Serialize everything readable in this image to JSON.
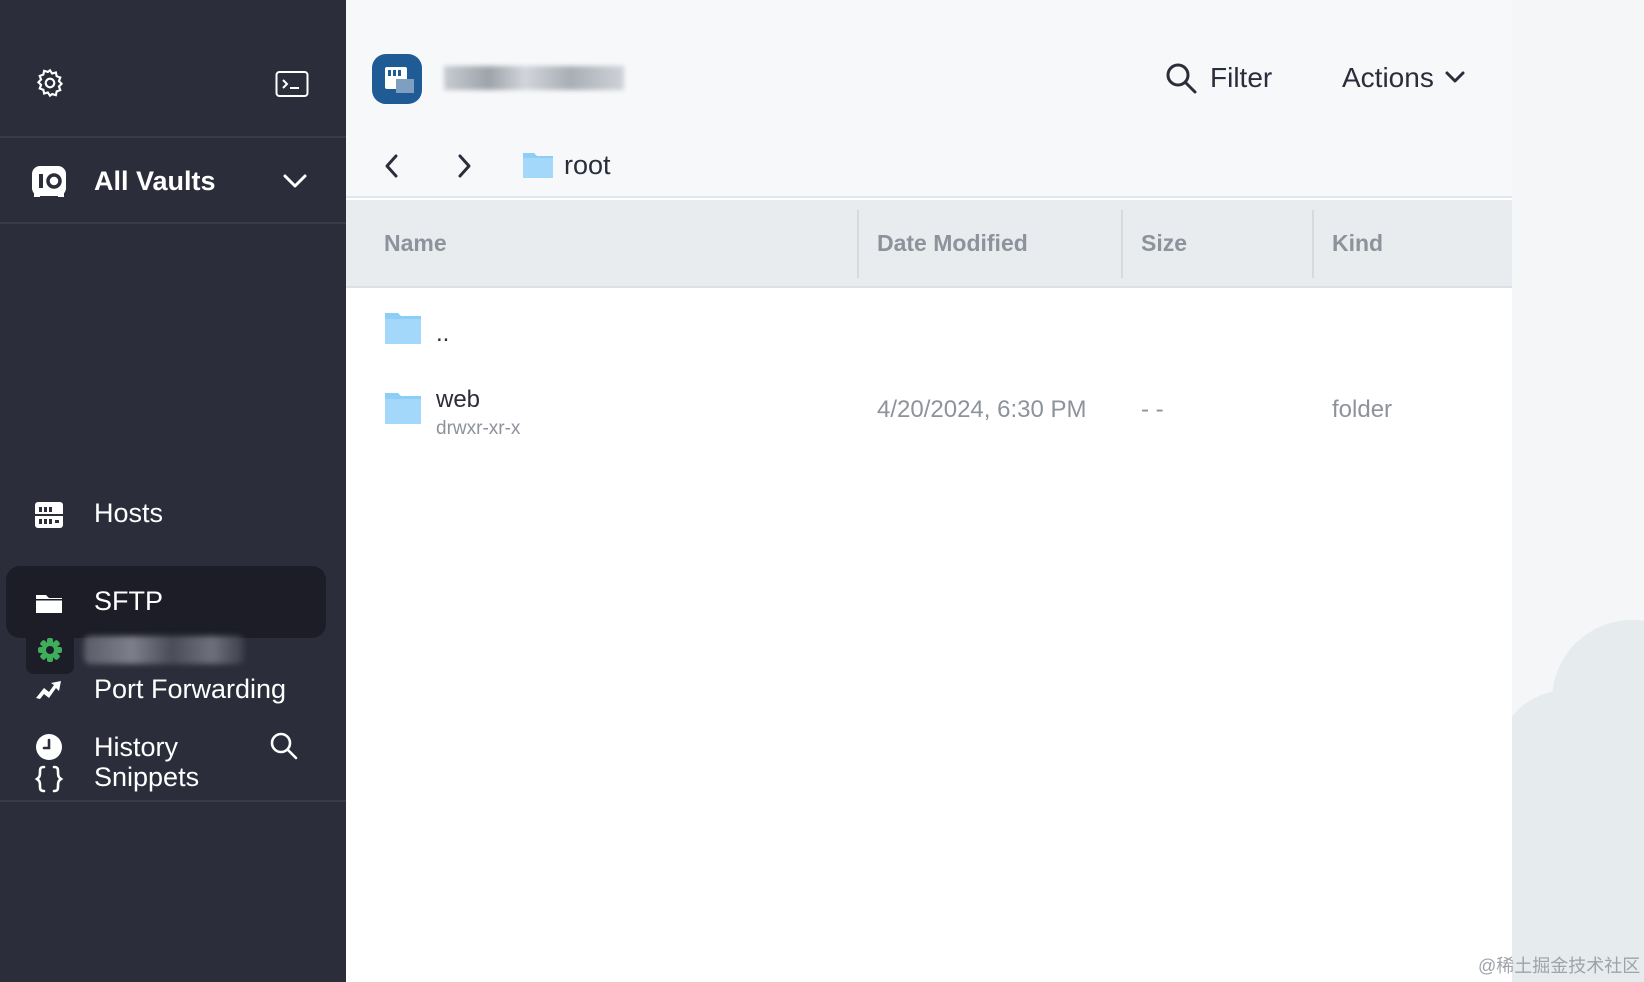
{
  "sidebar": {
    "vault_label": "All Vaults",
    "nav": [
      {
        "label": "Hosts",
        "icon": "hosts-icon"
      },
      {
        "label": "SFTP",
        "icon": "folder-icon",
        "active": true
      },
      {
        "label": "Port Forwarding",
        "icon": "port-forwarding-icon"
      },
      {
        "label": "Snippets",
        "icon": "snippets-icon"
      }
    ],
    "history_label": "History"
  },
  "header": {
    "filter_label": "Filter",
    "actions_label": "Actions",
    "breadcrumb": "root"
  },
  "table": {
    "columns": [
      "Name",
      "Date Modified",
      "Size",
      "Kind"
    ],
    "rows": [
      {
        "name": "..",
        "permissions": "",
        "date": "",
        "size": "",
        "kind": ""
      },
      {
        "name": "web",
        "permissions": "drwxr-xr-x",
        "date": "4/20/2024, 6:30 PM",
        "size": "- -",
        "kind": "folder"
      }
    ]
  },
  "watermark": "@稀土掘金技术社区",
  "colors": {
    "sidebar_bg": "#2b2d3a",
    "sidebar_active": "#1c1d27",
    "folder_blue": "#8ecdf5",
    "host_icon_bg": "#1f5b95"
  }
}
